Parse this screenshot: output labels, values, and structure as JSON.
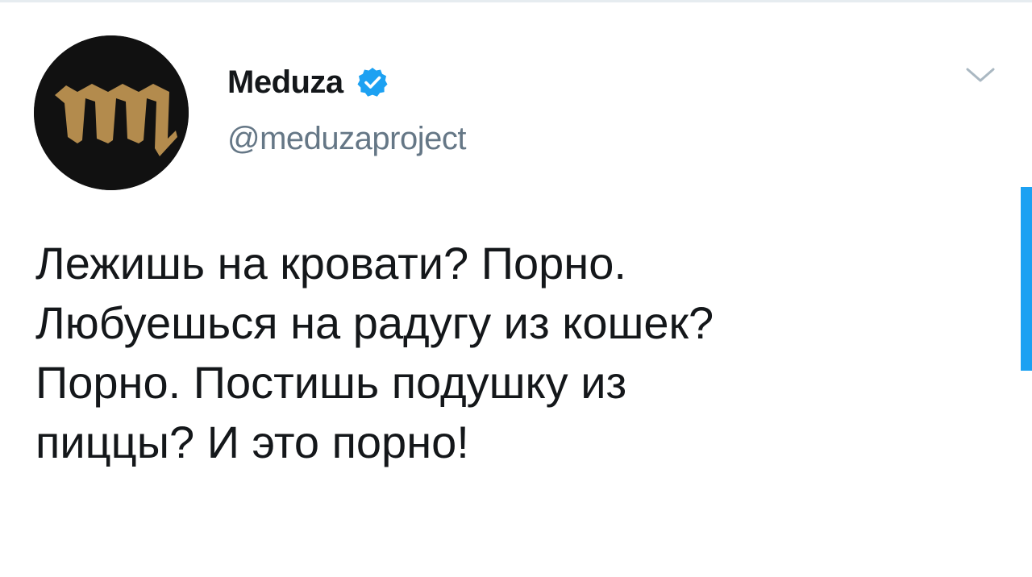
{
  "tweet": {
    "author": {
      "display_name": "Meduza",
      "handle": "@meduzaproject",
      "verified": true,
      "avatar_icon": "meduza-logo-icon",
      "avatar_colors": {
        "background": "#111111",
        "glyph": "#b38b4d"
      }
    },
    "menu_icon": "chevron-down-icon",
    "text_lines": [
      "Лежишь на кровати? Порно.",
      "Любуешься на радугу из кошек?",
      "Порно. Постишь подушку из",
      "пиццы? И это порно!"
    ]
  },
  "colors": {
    "verified_badge": "#1da1f2",
    "handle": "#657786",
    "text": "#14171a",
    "scroll_indicator": "#1da1f2"
  }
}
